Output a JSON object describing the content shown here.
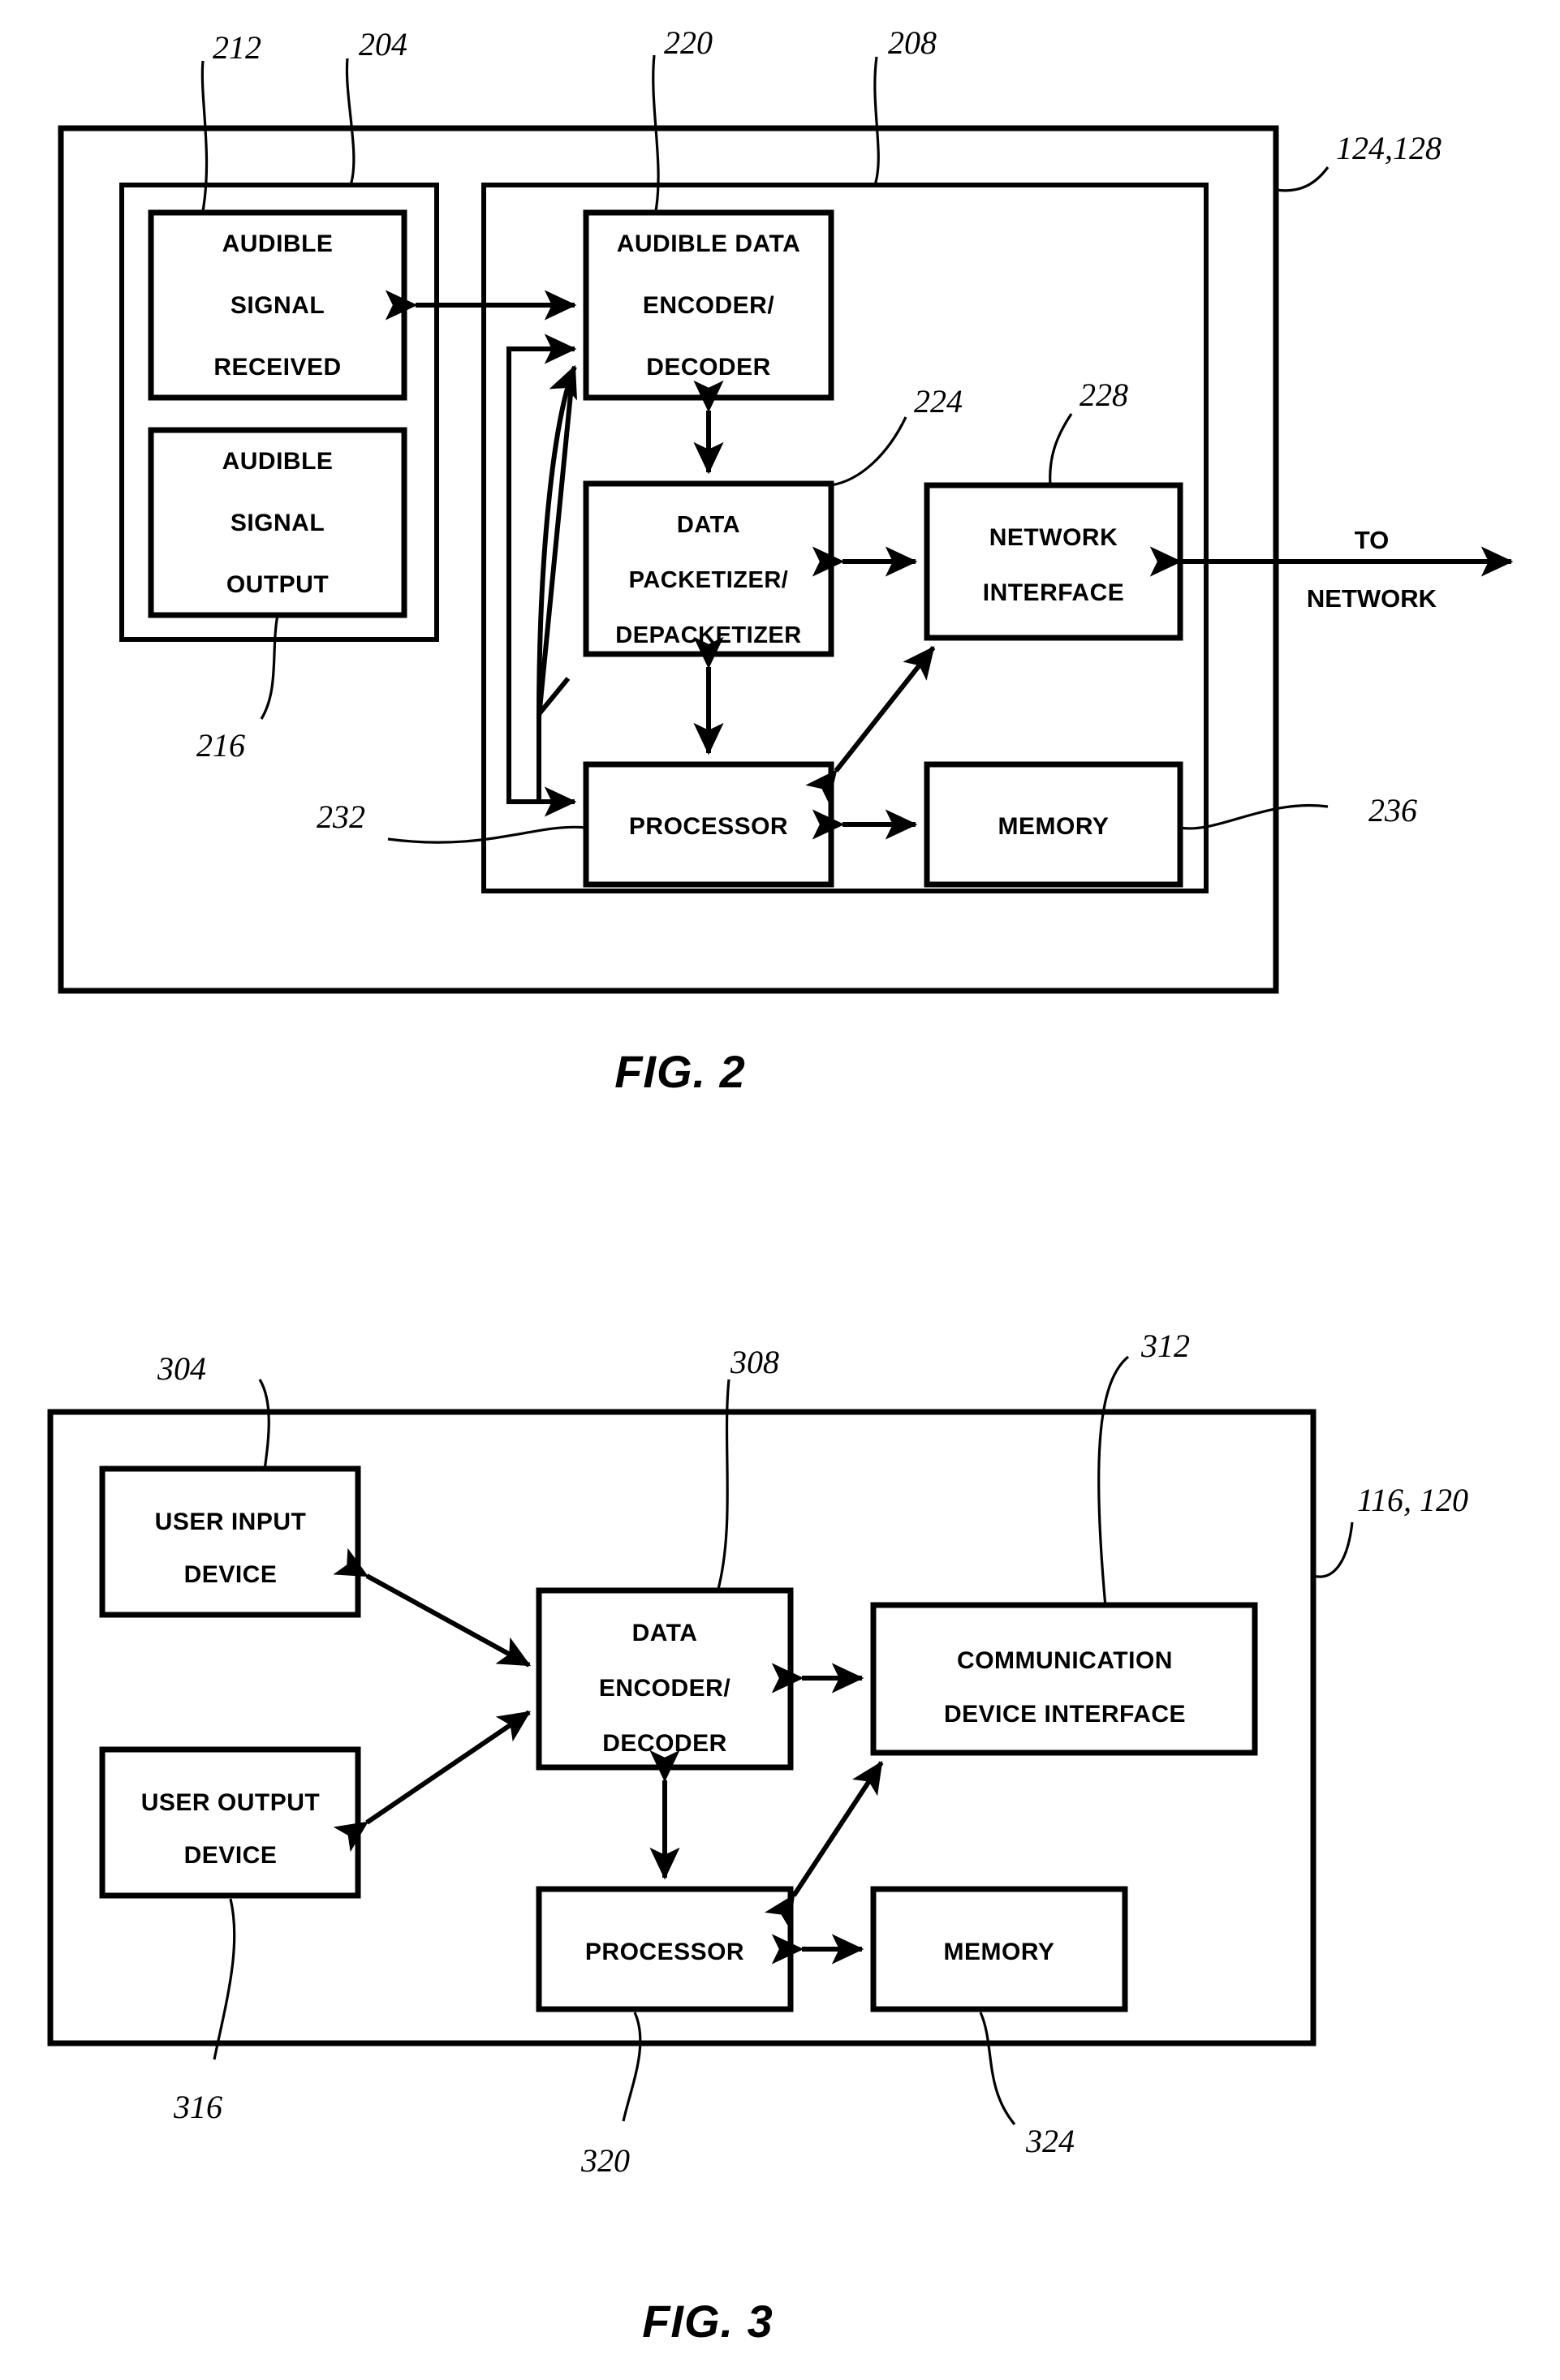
{
  "document": {
    "type": "patent-drawing-sheet",
    "figures": [
      {
        "caption": "FIG. 2",
        "outer_ref": "124,128",
        "external_label": {
          "line1": "TO",
          "line2": "NETWORK"
        },
        "blocks": [
          {
            "id": "audible-signal-received",
            "lines": [
              "AUDIBLE",
              "SIGNAL",
              "RECEIVED"
            ],
            "ref": "212"
          },
          {
            "id": "audible-signal-output",
            "lines": [
              "AUDIBLE",
              "SIGNAL",
              "OUTPUT"
            ],
            "ref": "216"
          },
          {
            "id": "audible-data-encoder-decoder",
            "lines": [
              "AUDIBLE DATA",
              "ENCODER/",
              "DECODER"
            ],
            "ref": "220"
          },
          {
            "id": "data-packetizer-depacketizer",
            "lines": [
              "DATA",
              "PACKETIZER/",
              "DEPACKETIZER"
            ],
            "ref": "224"
          },
          {
            "id": "network-interface",
            "lines": [
              "NETWORK",
              "INTERFACE"
            ],
            "ref": "228"
          },
          {
            "id": "processor",
            "lines": [
              "PROCESSOR"
            ],
            "ref": "232"
          },
          {
            "id": "memory",
            "lines": [
              "MEMORY"
            ],
            "ref": "236"
          }
        ],
        "group_refs": [
          {
            "id": "audio-subsystem-group",
            "ref": "204"
          },
          {
            "id": "processing-subsystem-group",
            "ref": "208"
          }
        ]
      },
      {
        "caption": "FIG. 3",
        "outer_ref": "116, 120",
        "blocks": [
          {
            "id": "user-input-device",
            "lines": [
              "USER INPUT",
              "DEVICE"
            ],
            "ref": "304"
          },
          {
            "id": "user-output-device",
            "lines": [
              "USER OUTPUT",
              "DEVICE"
            ],
            "ref": "316"
          },
          {
            "id": "data-encoder-decoder",
            "lines": [
              "DATA",
              "ENCODER/",
              "DECODER"
            ],
            "ref": "308"
          },
          {
            "id": "communication-device-interface",
            "lines": [
              "COMMUNICATION",
              "DEVICE INTERFACE"
            ],
            "ref": "312"
          },
          {
            "id": "processor",
            "lines": [
              "PROCESSOR"
            ],
            "ref": "320"
          },
          {
            "id": "memory",
            "lines": [
              "MEMORY"
            ],
            "ref": "324"
          }
        ]
      }
    ],
    "reference_numerals": [
      "212",
      "204",
      "220",
      "208",
      "124,128",
      "224",
      "228",
      "216",
      "232",
      "236",
      "304",
      "308",
      "312",
      "116, 120",
      "316",
      "320",
      "324"
    ]
  },
  "fig2": {
    "caption": "FIG. 2",
    "outer_ref": "124,128",
    "ref_212": "212",
    "ref_204": "204",
    "ref_220": "220",
    "ref_208": "208",
    "ref_224": "224",
    "ref_228": "228",
    "ref_216": "216",
    "ref_232": "232",
    "ref_236": "236",
    "b_asr_1": "AUDIBLE",
    "b_asr_2": "SIGNAL",
    "b_asr_3": "RECEIVED",
    "b_aso_1": "AUDIBLE",
    "b_aso_2": "SIGNAL",
    "b_aso_3": "OUTPUT",
    "b_ade_1": "AUDIBLE DATA",
    "b_ade_2": "ENCODER/",
    "b_ade_3": "DECODER",
    "b_dpd_1": "DATA",
    "b_dpd_2": "PACKETIZER/",
    "b_dpd_3": "DEPACKETIZER",
    "b_ni_1": "NETWORK",
    "b_ni_2": "INTERFACE",
    "b_proc": "PROCESSOR",
    "b_mem": "MEMORY",
    "to_network_1": "TO",
    "to_network_2": "NETWORK"
  },
  "fig3": {
    "caption": "FIG. 3",
    "outer_ref": "116, 120",
    "ref_304": "304",
    "ref_308": "308",
    "ref_312": "312",
    "ref_316": "316",
    "ref_320": "320",
    "ref_324": "324",
    "b_uid_1": "USER INPUT",
    "b_uid_2": "DEVICE",
    "b_uod_1": "USER OUTPUT",
    "b_uod_2": "DEVICE",
    "b_ded_1": "DATA",
    "b_ded_2": "ENCODER/",
    "b_ded_3": "DECODER",
    "b_cdi_1": "COMMUNICATION",
    "b_cdi_2": "DEVICE INTERFACE",
    "b_proc": "PROCESSOR",
    "b_mem": "MEMORY"
  },
  "colors": {
    "ink": "#000000",
    "paper": "#ffffff"
  }
}
